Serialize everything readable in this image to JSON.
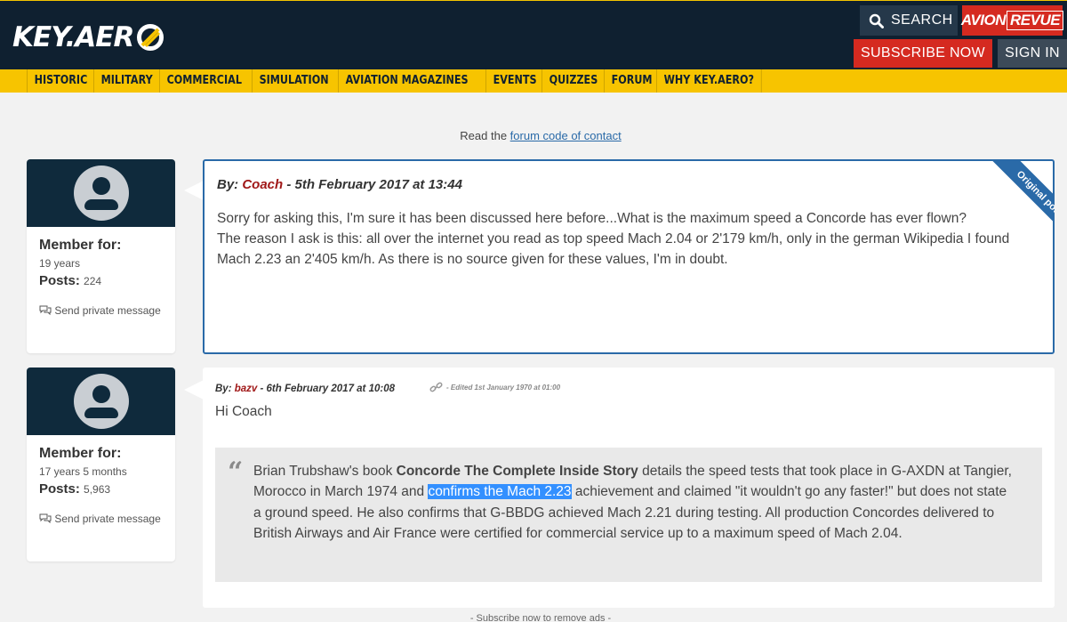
{
  "header": {
    "logo_text": "KEY.AER",
    "search_label": "SEARCH",
    "avion_label": "AVION",
    "revue_label": "REVUE",
    "subscribe_label": "SUBSCRIBE NOW",
    "signin_label": "SIGN IN"
  },
  "nav": {
    "items": [
      "HISTORIC",
      "MILITARY",
      "COMMERCIAL",
      "SIMULATION",
      "AVIATION MAGAZINES",
      "EVENTS",
      "QUIZZES",
      "FORUM",
      "WHY KEY.AERO?"
    ]
  },
  "notice": {
    "prefix": "Read the ",
    "link": "forum code of contact"
  },
  "posts": [
    {
      "by_label": "By:",
      "user": "Coach",
      "date": " - 5th February 2017 at 13:44",
      "ribbon": "Original post",
      "body_line1": "Sorry for asking this, I'm sure it has been discussed here before...What is the maximum speed a Concorde has ever flown?",
      "body_line2": "The reason I ask is this: all over the internet you read as top speed Mach 2.04 or 2'179 km/h, only in the german Wikipedia I found Mach 2.23 an 2'405 km/h. As there is no source given for these values, I'm in doubt.",
      "author": {
        "member_label": "Member for:",
        "member_value": "19 years",
        "posts_label": "Posts:",
        "posts_value": "224",
        "send_pm": "Send private message"
      }
    },
    {
      "by_label": "By:",
      "user": "bazv",
      "date": " - 6th February 2017 at 10:08",
      "edited": "- Edited 1st January 1970 at 01:00",
      "greeting": "Hi Coach",
      "quote": {
        "part1": "Brian Trubshaw's book ",
        "book_title": "Concorde The Complete Inside Story",
        "part2": " details the speed tests that took place in G-AXDN at Tangier, Morocco in March 1974 and ",
        "highlight": "confirms the Mach 2.23",
        "part3": " achievement and claimed \"it wouldn't go any faster!\" but does not state a ground speed. He also confirms that G-BBDG achieved Mach 2.21 during testing. All production Concordes delivered to British Airways and Air France were certified for commercial service up to a maximum speed of Mach 2.04."
      },
      "author": {
        "member_label": "Member for:",
        "member_value": "17 years 5 months",
        "posts_label": "Posts:",
        "posts_value": "5,963",
        "send_pm": "Send private message"
      }
    }
  ],
  "footer_note": "- Subscribe now to remove ads -"
}
